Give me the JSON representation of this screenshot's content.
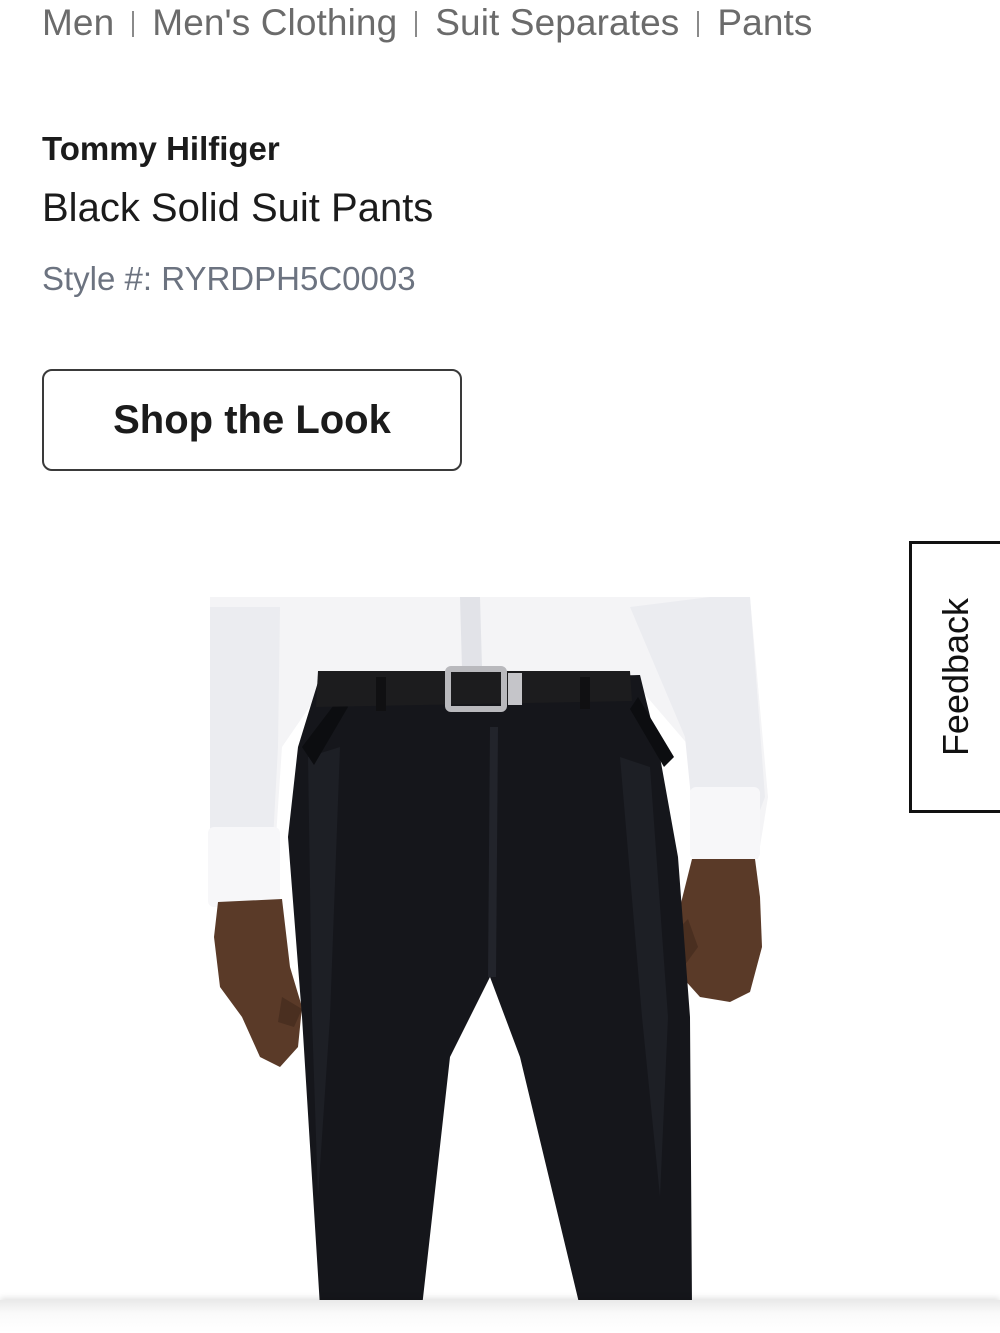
{
  "breadcrumb": [
    {
      "label": "Men"
    },
    {
      "label": "Men's Clothing"
    },
    {
      "label": "Suit Separates"
    },
    {
      "label": "Pants"
    }
  ],
  "product": {
    "brand": "Tommy Hilfiger",
    "name": "Black Solid Suit Pants",
    "style": "Style #: RYRDPH5C0003"
  },
  "actions": {
    "shop_the_look": "Shop the Look"
  },
  "feedback": {
    "label": "Feedback"
  },
  "image": {
    "subject": "model wearing black suit pants, white shirt and black belt",
    "colors": {
      "pants": "#15161b",
      "shirt": "#f4f4f6",
      "skin": "#5a3a28",
      "belt": "#1c1c1e"
    }
  }
}
